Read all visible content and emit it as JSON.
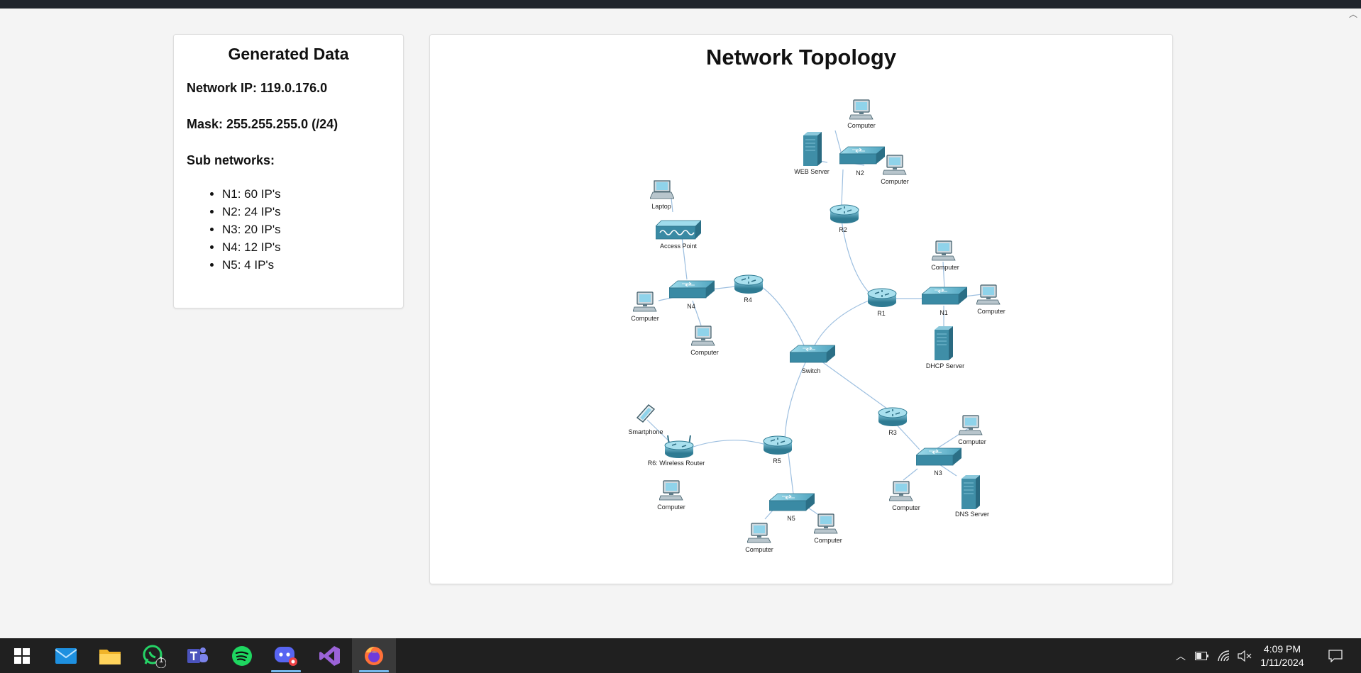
{
  "generated": {
    "title": "Generated Data",
    "network_ip": "Network IP: 119.0.176.0",
    "mask": "Mask: 255.255.255.0 (/24)",
    "subnetworks_heading": "Sub networks:",
    "subnetworks": [
      "N1: 60 IP's",
      "N2: 24 IP's",
      "N3: 20 IP's",
      "N4: 12 IP's",
      "N5: 4 IP's"
    ]
  },
  "topology": {
    "title": "Network Topology",
    "labels": {
      "pc_n2_top": "Computer",
      "web_server": "WEB Server",
      "n2": "N2",
      "pc_n2_right": "Computer",
      "r2": "R2",
      "laptop": "Laptop",
      "access_point": "Access Point",
      "pc_n1_top": "Computer",
      "r4": "R4",
      "n4": "N4",
      "pc_n4_left": "Computer",
      "r1": "R1",
      "n1": "N1",
      "pc_n1_right": "Computer",
      "pc_n4_bottom": "Computer",
      "dhcp_server": "DHCP Server",
      "switch": "Switch",
      "smartphone": "Smartphone",
      "r3": "R3",
      "pc_n3_top": "Computer",
      "r6": "R6: Wireless Router",
      "r5": "R5",
      "n3": "N3",
      "pc_r6": "Computer",
      "pc_n3_left": "Computer",
      "dns_server": "DNS Server",
      "n5": "N5",
      "pc_n5_right": "Computer",
      "pc_n5_left": "Computer"
    }
  },
  "taskbar": {
    "apps": [
      "windows-start",
      "mail",
      "file-explorer",
      "whatsapp",
      "teams",
      "spotify",
      "discord",
      "visual-studio",
      "firefox"
    ],
    "whatsapp_badge": "1",
    "time": "4:09 PM",
    "date": "1/11/2024"
  },
  "colors": {
    "device": "#3e8ea6",
    "link": "#9dbfe0",
    "taskbar": "#202020"
  }
}
